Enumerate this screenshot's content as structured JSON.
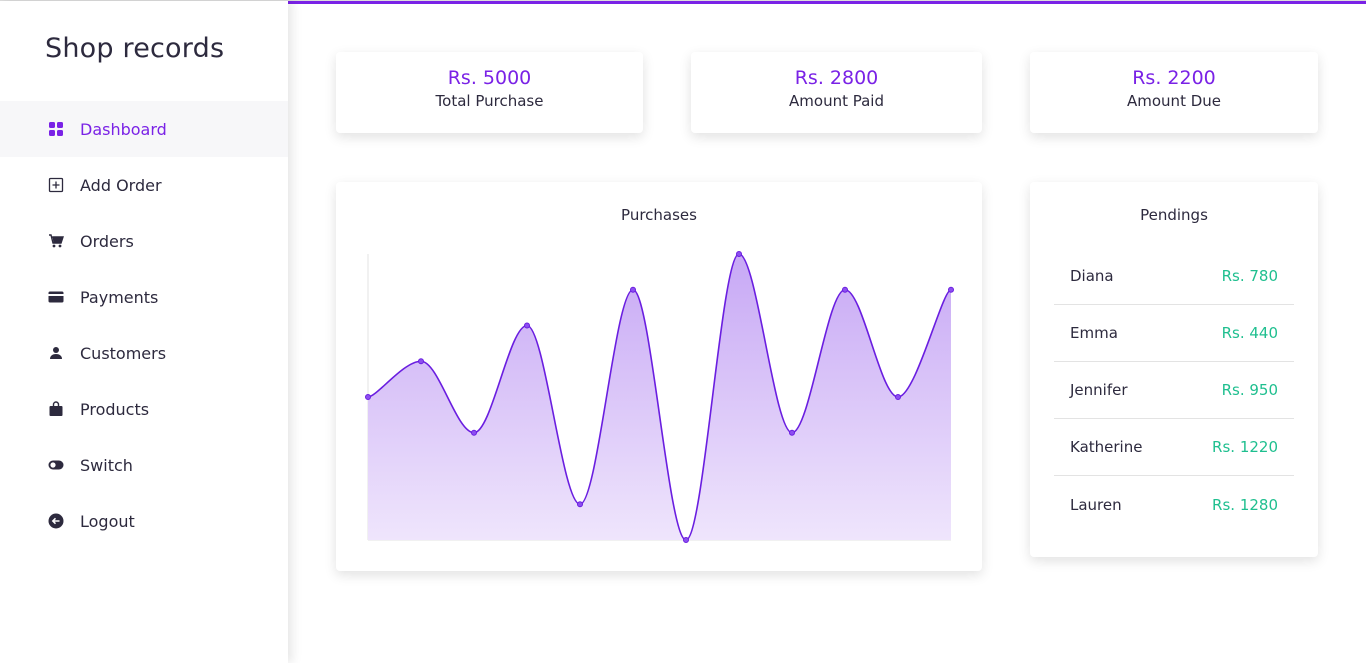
{
  "sidebar": {
    "brand": "Shop records",
    "items": [
      {
        "label": "Dashboard",
        "icon": "dashboard-icon",
        "active": true
      },
      {
        "label": "Add Order",
        "icon": "add-box-icon",
        "active": false
      },
      {
        "label": "Orders",
        "icon": "cart-icon",
        "active": false
      },
      {
        "label": "Payments",
        "icon": "credit-card-icon",
        "active": false
      },
      {
        "label": "Customers",
        "icon": "person-icon",
        "active": false
      },
      {
        "label": "Products",
        "icon": "bag-icon",
        "active": false
      },
      {
        "label": "Switch",
        "icon": "toggle-icon",
        "active": false
      },
      {
        "label": "Logout",
        "icon": "logout-icon",
        "active": false
      }
    ]
  },
  "stats": [
    {
      "value": "Rs. 5000",
      "label": "Total Purchase"
    },
    {
      "value": "Rs. 2800",
      "label": "Amount Paid"
    },
    {
      "value": "Rs. 2200",
      "label": "Amount Due"
    }
  ],
  "colors": {
    "accent": "#7a22e6",
    "positive": "#1fbf8f",
    "text": "#2d2a3e"
  },
  "chart_data": {
    "type": "area",
    "title": "Purchases",
    "xlabel": "",
    "ylabel": "",
    "x": [
      0,
      1,
      2,
      3,
      4,
      5,
      6,
      7,
      8,
      9,
      10,
      11
    ],
    "values": [
      4,
      5,
      3,
      6,
      1,
      7,
      0,
      8,
      3,
      7,
      4,
      7
    ],
    "ylim": [
      0,
      8
    ],
    "grid": false,
    "legend": false
  },
  "pendings": {
    "title": "Pendings",
    "rows": [
      {
        "name": "Diana",
        "amount": "Rs. 780"
      },
      {
        "name": "Emma",
        "amount": "Rs. 440"
      },
      {
        "name": "Jennifer",
        "amount": "Rs. 950"
      },
      {
        "name": "Katherine",
        "amount": "Rs. 1220"
      },
      {
        "name": "Lauren",
        "amount": "Rs. 1280"
      }
    ]
  }
}
